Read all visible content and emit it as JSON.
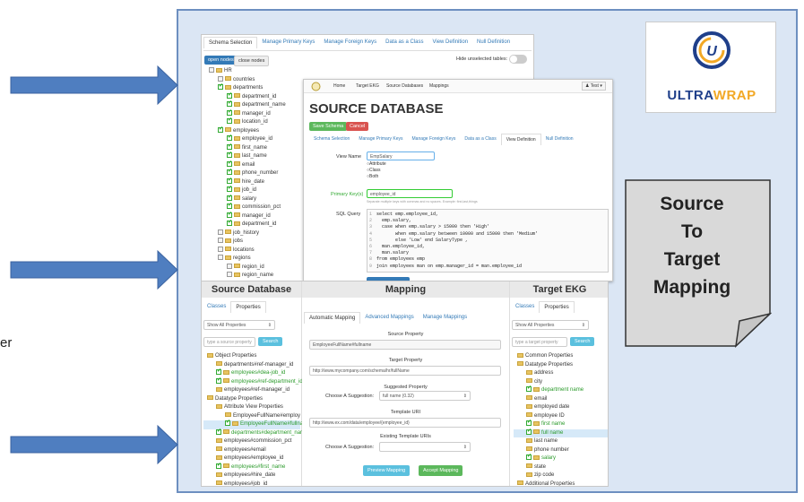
{
  "colors": {
    "panel_bg": "#dbe6f4",
    "panel_border": "#6d8fc0",
    "arrow": "#4f7ec0",
    "accent": "#337ab7",
    "green": "#5cb85c",
    "red": "#d9534f",
    "note_bg": "#d9d9d9"
  },
  "fragment_text": "er",
  "logo": {
    "word_a": "ULTRA",
    "word_b": "WRAP"
  },
  "note": {
    "line1": "Source",
    "line2": "To",
    "line3": "Target",
    "line4": "Mapping"
  },
  "schema": {
    "tabs": [
      "Schema Selection",
      "Manage Primary Keys",
      "Manage Foreign Keys",
      "Data as a Class",
      "View Definition",
      "Null Definition"
    ],
    "open_nodes": "open nodes",
    "close_nodes": "close nodes",
    "hide_unselected": "Hide unselected tables:",
    "tree": [
      {
        "label": "HR",
        "indent": 0,
        "chk": false
      },
      {
        "label": "countries",
        "indent": 1,
        "chk": false
      },
      {
        "label": "departments",
        "indent": 1,
        "chk": true
      },
      {
        "label": "department_id",
        "indent": 2,
        "chk": true
      },
      {
        "label": "department_name",
        "indent": 2,
        "chk": true
      },
      {
        "label": "manager_id",
        "indent": 2,
        "chk": true
      },
      {
        "label": "location_id",
        "indent": 2,
        "chk": true
      },
      {
        "label": "employees",
        "indent": 1,
        "chk": true
      },
      {
        "label": "employee_id",
        "indent": 2,
        "chk": true
      },
      {
        "label": "first_name",
        "indent": 2,
        "chk": true
      },
      {
        "label": "last_name",
        "indent": 2,
        "chk": true
      },
      {
        "label": "email",
        "indent": 2,
        "chk": true
      },
      {
        "label": "phone_number",
        "indent": 2,
        "chk": true
      },
      {
        "label": "hire_date",
        "indent": 2,
        "chk": true
      },
      {
        "label": "job_id",
        "indent": 2,
        "chk": true
      },
      {
        "label": "salary",
        "indent": 2,
        "chk": true
      },
      {
        "label": "commission_pct",
        "indent": 2,
        "chk": true
      },
      {
        "label": "manager_id",
        "indent": 2,
        "chk": true
      },
      {
        "label": "department_id",
        "indent": 2,
        "chk": true
      },
      {
        "label": "job_history",
        "indent": 1,
        "chk": false
      },
      {
        "label": "jobs",
        "indent": 1,
        "chk": false
      },
      {
        "label": "locations",
        "indent": 1,
        "chk": false
      },
      {
        "label": "regions",
        "indent": 1,
        "chk": false
      },
      {
        "label": "region_id",
        "indent": 2,
        "chk": false
      },
      {
        "label": "region_name",
        "indent": 2,
        "chk": false
      }
    ]
  },
  "source_db": {
    "nav": [
      "Home",
      "Target EKG",
      "Source Databases",
      "Mappings"
    ],
    "user": "Test",
    "title": "SOURCE DATABASE",
    "save": "Save Schema",
    "cancel": "Cancel",
    "tabs": [
      "Schema Selection",
      "Manage Primary Keys",
      "Manage Foreign Keys",
      "Data as a Class",
      "View Definition",
      "Null Definition"
    ],
    "view_name_label": "View Name",
    "view_name_value": "EmpSalary",
    "radio": [
      "Attribute",
      "Class",
      "Both"
    ],
    "pk_label": "Primary Key(s)",
    "pk_value": "employee_id",
    "pk_help": "Separate multiple keys with commas and no spaces. Example: first,last,things",
    "sql_label": "SQL Query",
    "sql": [
      "select emp.employee_id,",
      "  emp.salary,",
      "  case when emp.salary > 15000 then 'High'",
      "       when emp.salary between 10000 and 15000 then 'Medium'",
      "       else 'Low' end SalaryType ,",
      "  man.employee_id,",
      "  man.salary",
      "from employees emp",
      "join employees man on emp.manager_id = man.employee_id"
    ]
  },
  "mapping": {
    "left_title": "Source Database",
    "left_tabs": [
      "Classes",
      "Properties"
    ],
    "left_select": "Show All Properties",
    "left_search_ph": "type a source property",
    "search": "Search",
    "left_tree": [
      {
        "label": "Object Properties",
        "indent": 0,
        "color": "n"
      },
      {
        "label": "departments#ref-manager_id",
        "indent": 1,
        "color": "n"
      },
      {
        "label": "employees#dea-job_id",
        "indent": 1,
        "color": "g"
      },
      {
        "label": "employees#ref-department_id",
        "indent": 1,
        "color": "g"
      },
      {
        "label": "employees#ref-manager_id",
        "indent": 1,
        "color": "n"
      },
      {
        "label": "Datatype Properties",
        "indent": 0,
        "color": "n"
      },
      {
        "label": "Attribute View Properties",
        "indent": 1,
        "color": "n"
      },
      {
        "label": "EmployeeFullName#employ",
        "indent": 2,
        "color": "n"
      },
      {
        "label": "EmployeeFullName#fullnam",
        "indent": 2,
        "color": "sel"
      },
      {
        "label": "departments#department_name",
        "indent": 1,
        "color": "g"
      },
      {
        "label": "employees#commission_pct",
        "indent": 1,
        "color": "n"
      },
      {
        "label": "employees#email",
        "indent": 1,
        "color": "n"
      },
      {
        "label": "employees#employee_id",
        "indent": 1,
        "color": "n"
      },
      {
        "label": "employees#first_name",
        "indent": 1,
        "color": "g"
      },
      {
        "label": "employees#hire_date",
        "indent": 1,
        "color": "n"
      },
      {
        "label": "employees#job_id",
        "indent": 1,
        "color": "n"
      }
    ],
    "mid_title": "Mapping",
    "mid_tabs": [
      "Automatic Mapping",
      "Advanced Mappings",
      "Manage Mappings"
    ],
    "source_prop_label": "Source Property",
    "source_prop": "EmployeeFullName#fullname",
    "target_prop_label": "Target Property",
    "target_prop": "http://www.mycompany.com/schema/hr/fullName",
    "suggested_label": "Suggested Property",
    "choose_label": "Choose A Suggestion:",
    "suggestion": "full name (0.32)",
    "template_label": "Template URI",
    "template": "http://www.ex.com/data/employee/{employee_id}",
    "existing_label": "Existing Template URIs",
    "choose_label2": "Choose A Suggestion:",
    "preview": "Preview Mapping",
    "accept": "Accept Mapping",
    "right_title": "Target EKG",
    "right_tabs": [
      "Classes",
      "Properties"
    ],
    "right_select": "Show All Properties",
    "right_search_ph": "type a target property",
    "right_tree": [
      {
        "label": "Common Properties",
        "indent": 0,
        "color": "n"
      },
      {
        "label": "Datatype Properties",
        "indent": 0,
        "color": "n"
      },
      {
        "label": "address",
        "indent": 1,
        "color": "n"
      },
      {
        "label": "city",
        "indent": 1,
        "color": "n"
      },
      {
        "label": "department name",
        "indent": 1,
        "color": "g"
      },
      {
        "label": "email",
        "indent": 1,
        "color": "n"
      },
      {
        "label": "employed date",
        "indent": 1,
        "color": "n"
      },
      {
        "label": "employee ID",
        "indent": 1,
        "color": "n"
      },
      {
        "label": "first name",
        "indent": 1,
        "color": "g"
      },
      {
        "label": "full name",
        "indent": 1,
        "color": "sel"
      },
      {
        "label": "last name",
        "indent": 1,
        "color": "n"
      },
      {
        "label": "phone number",
        "indent": 1,
        "color": "n"
      },
      {
        "label": "salary",
        "indent": 1,
        "color": "g"
      },
      {
        "label": "state",
        "indent": 1,
        "color": "n"
      },
      {
        "label": "zip code",
        "indent": 1,
        "color": "n"
      },
      {
        "label": "Additional Properties",
        "indent": 0,
        "color": "n"
      }
    ]
  }
}
